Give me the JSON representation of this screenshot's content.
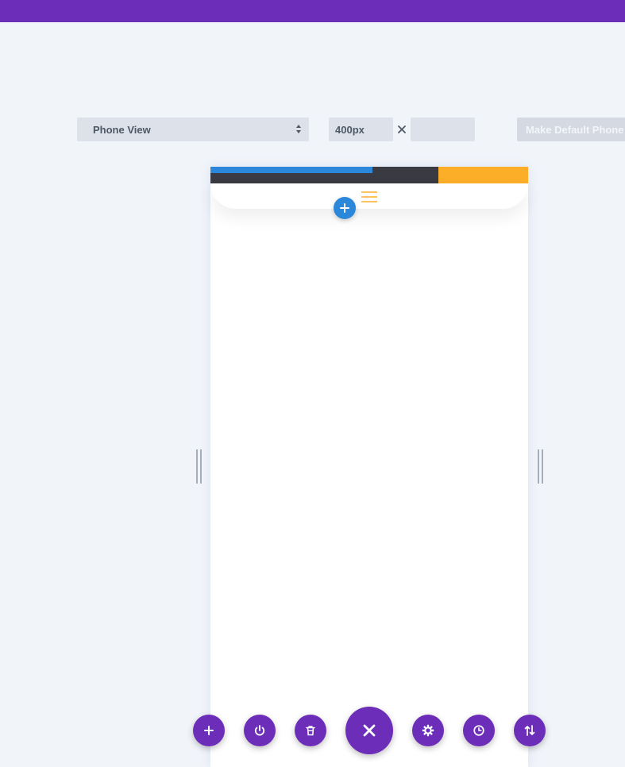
{
  "toolbar": {
    "view_select_value": "Phone View",
    "width_value": "400px",
    "height_value": "",
    "dimension_separator": "×",
    "make_default_label": "Make Default Phone"
  },
  "colors": {
    "brand_purple": "#6c2eb9",
    "accent_blue": "#2b87da",
    "accent_orange": "#fdae29",
    "header_dark": "#3a3a42",
    "canvas_bg": "#f1f4f9"
  },
  "icons": {
    "menu": "hamburger-icon",
    "add_module": "plus-icon",
    "resize": "resize-handle",
    "bottom_actions": [
      "plus-icon",
      "power-icon",
      "trash-icon",
      "close-icon",
      "gear-icon",
      "history-icon",
      "sort-icon"
    ]
  }
}
